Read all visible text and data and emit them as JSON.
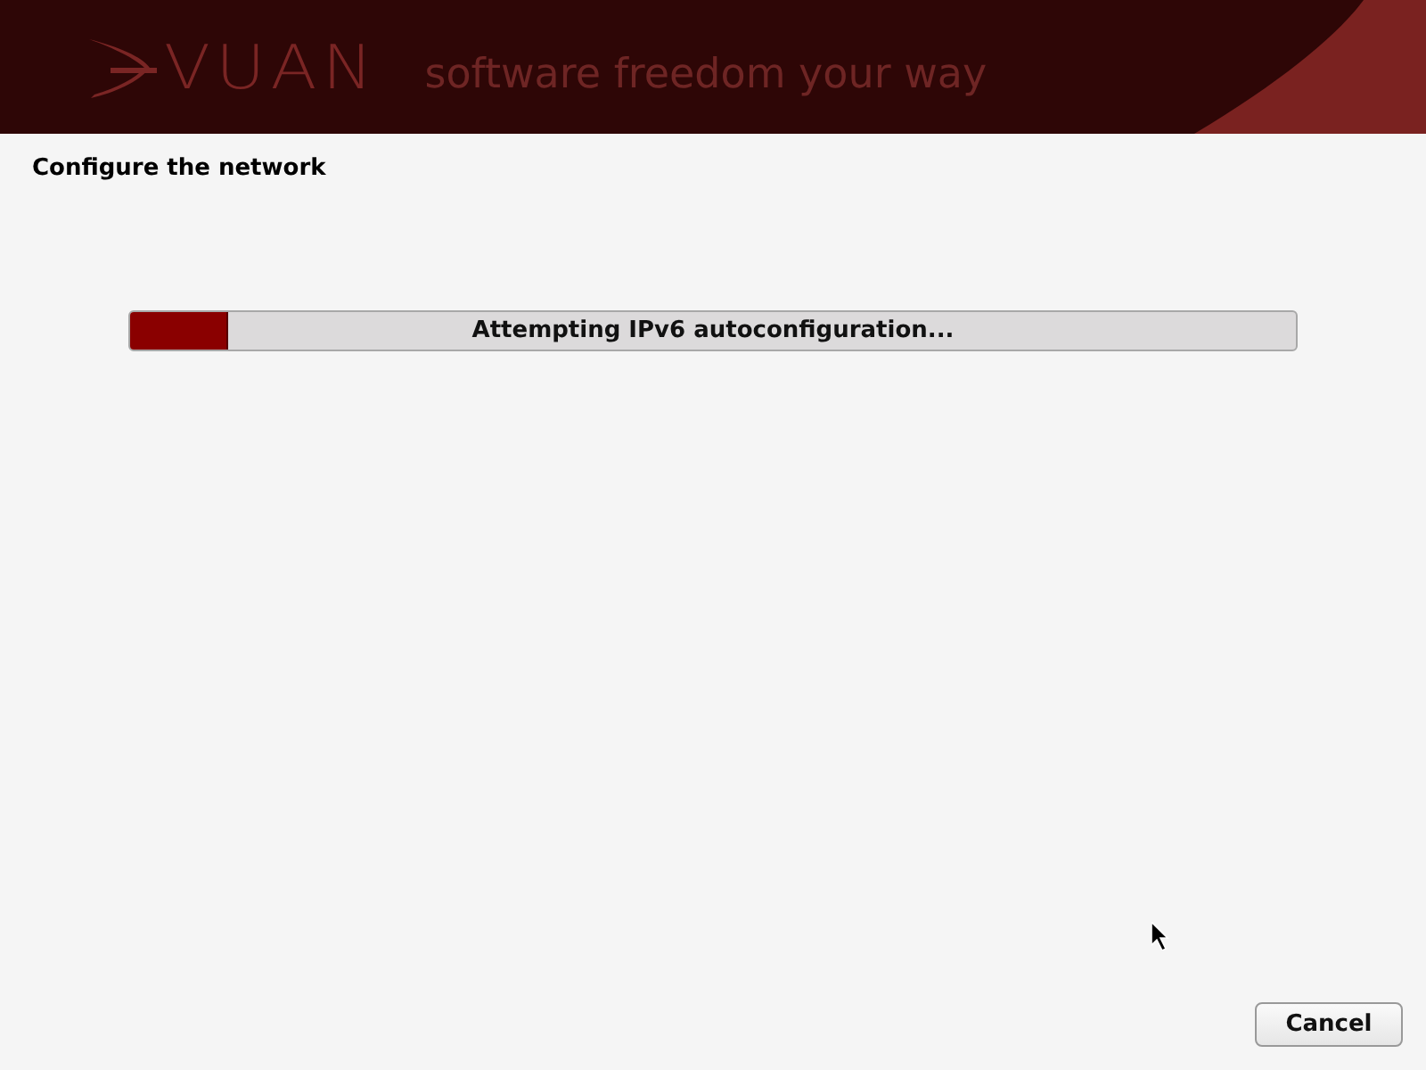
{
  "banner": {
    "wordmark": "VUAN",
    "tagline": "software freedom your way"
  },
  "title": "Configure the network",
  "progress": {
    "level": 0.083,
    "label": "Attempting IPv6 autoconfiguration..."
  },
  "buttons": [
    {
      "label": "Cancel"
    }
  ]
}
